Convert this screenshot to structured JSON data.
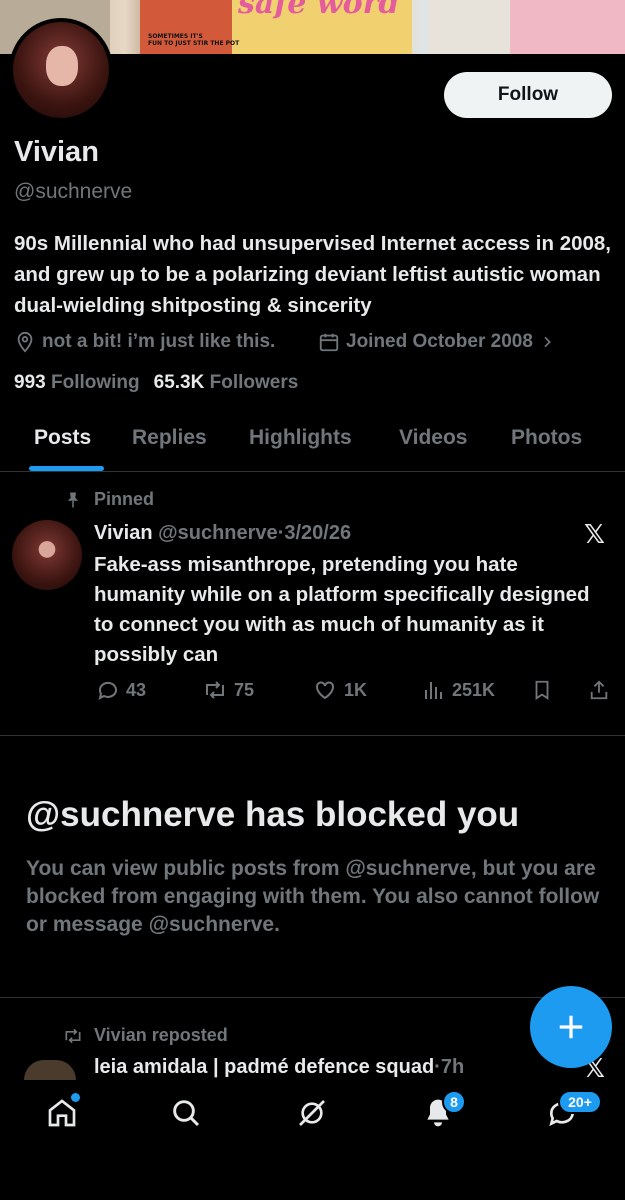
{
  "banner": {
    "word": "safe word",
    "caption_line1": "SOMETIMES IT'S",
    "caption_line2": "FUN TO JUST STIR THE POT"
  },
  "profile": {
    "name": "Vivian",
    "handle": "@suchnerve",
    "follow_label": "Follow",
    "bio": "90s Millennial who had unsupervised Internet access in 2008, and grew up to be a polarizing deviant leftist autistic woman dual-wielding shitposting & sincerity",
    "location": "not a bit! i’m just like this.",
    "joined": "Joined October 2008",
    "following_count": "993",
    "following_label": "Following",
    "followers_count": "65.3K",
    "followers_label": "Followers"
  },
  "tabs": [
    {
      "label": "Posts"
    },
    {
      "label": "Replies"
    },
    {
      "label": "Highlights"
    },
    {
      "label": "Videos"
    },
    {
      "label": "Photos"
    }
  ],
  "pinned_post": {
    "pinned_label": "Pinned",
    "author_name": "Vivian",
    "author_handle": "@suchnerve",
    "separator": "·",
    "date": "3/20/26",
    "text": "Fake-ass misanthrope, pretending you hate humanity while on a platform specifically designed to connect you with as much of humanity as it possibly can",
    "replies": "43",
    "reposts": "75",
    "likes": "1K",
    "views": "251K"
  },
  "blocked": {
    "title": "@suchnerve has blocked you",
    "description": "You can view public posts from @suchnerve, but you are blocked from engaging with them. You also cannot follow or message @suchnerve."
  },
  "repost": {
    "label": "Vivian reposted",
    "author": "leia amidala | padmé defence squad",
    "separator": "·",
    "time": "7h"
  },
  "nav": {
    "notifications_badge": "8",
    "messages_badge": "20+"
  },
  "colors": {
    "accent": "#1d9bf0",
    "text": "#e7e9ea",
    "muted": "#71767b",
    "background": "#000000",
    "border": "#2f3336"
  }
}
